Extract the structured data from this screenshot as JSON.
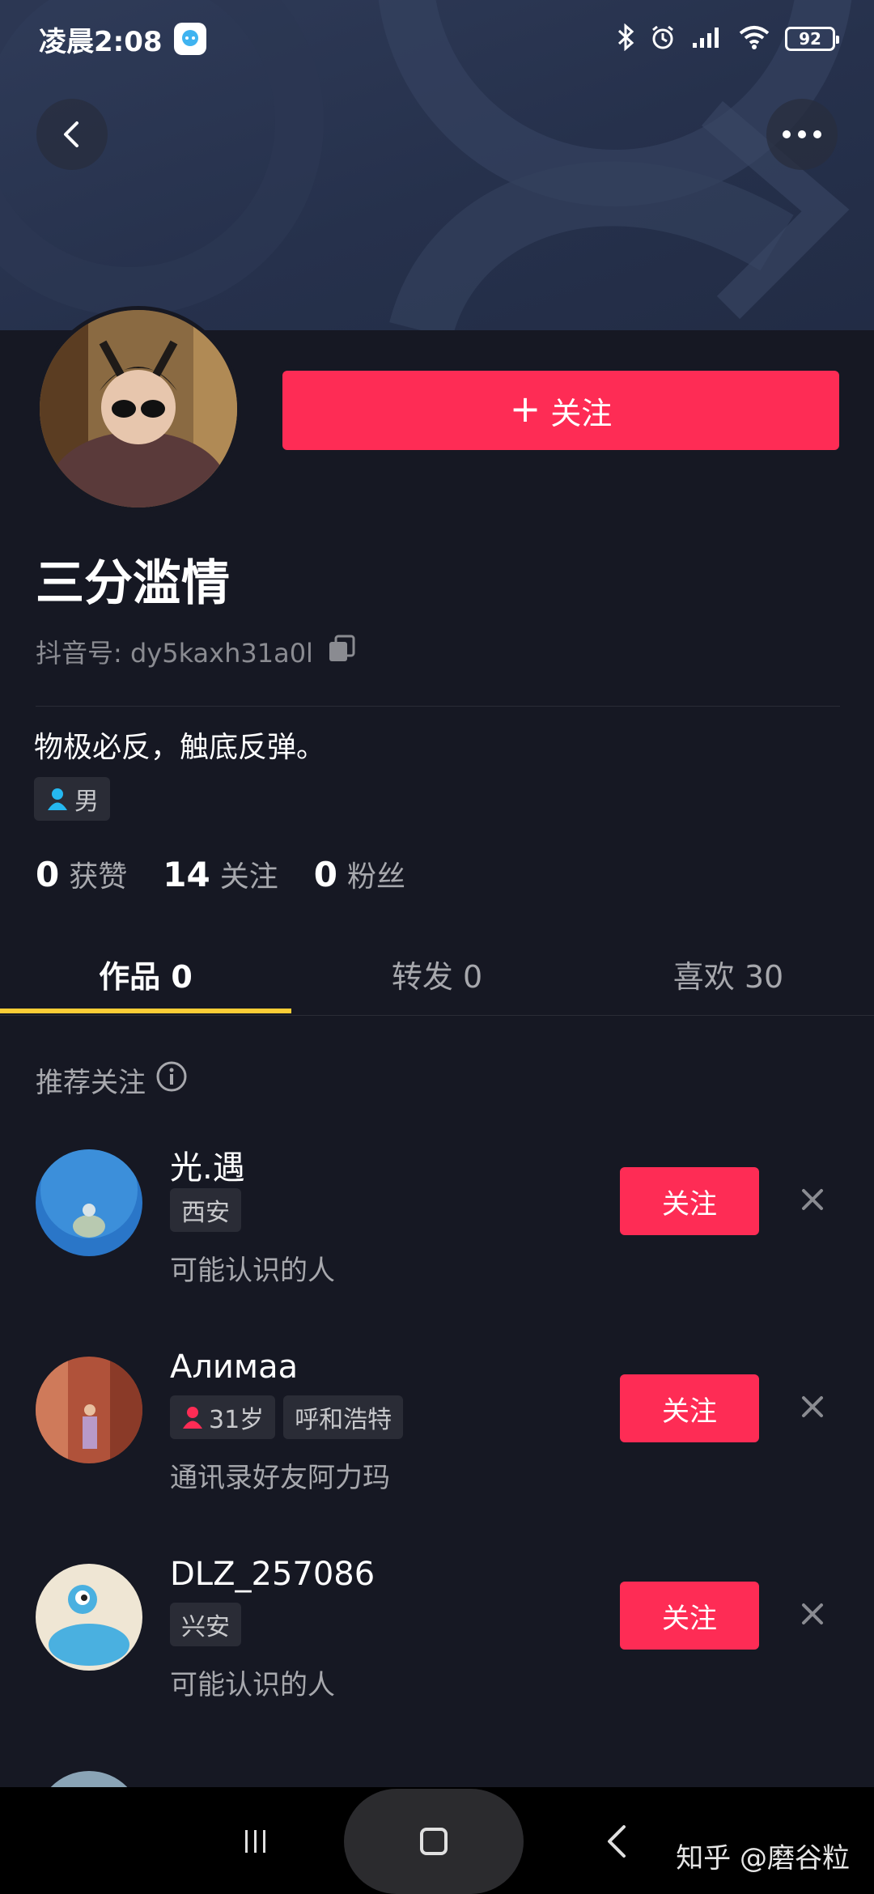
{
  "status_bar": {
    "time": "凌晨2:08",
    "battery": "92"
  },
  "profile": {
    "follow_button": "关注",
    "nickname": "三分滥情",
    "id_label": "抖音号: dy5kaxh31a0l",
    "bio": "物极必反，触底反弹。",
    "gender": "男",
    "stats": [
      {
        "value": "0",
        "label": "获赞"
      },
      {
        "value": "14",
        "label": "关注"
      },
      {
        "value": "0",
        "label": "粉丝"
      }
    ]
  },
  "tabs": [
    {
      "label": "作品 0",
      "active": true
    },
    {
      "label": "转发 0",
      "active": false
    },
    {
      "label": "喜欢 30",
      "active": false
    }
  ],
  "recommend": {
    "header": "推荐关注",
    "items": [
      {
        "name": "光.遇",
        "tags": [
          "西安"
        ],
        "reason": "可能认识的人",
        "follow": "关注"
      },
      {
        "name": "Алимаа",
        "tags": [
          "31岁",
          "呼和浩特"
        ],
        "reason": "通讯录好友阿力玛",
        "follow": "关注"
      },
      {
        "name": "DLZ_257086",
        "tags": [
          "兴安"
        ],
        "reason": "可能认识的人",
        "follow": "关注"
      }
    ]
  },
  "watermark": "知乎 @磨谷粒",
  "colors": {
    "background": "#161823",
    "accent": "#fe2c55",
    "tab_indicator": "#facd36"
  }
}
